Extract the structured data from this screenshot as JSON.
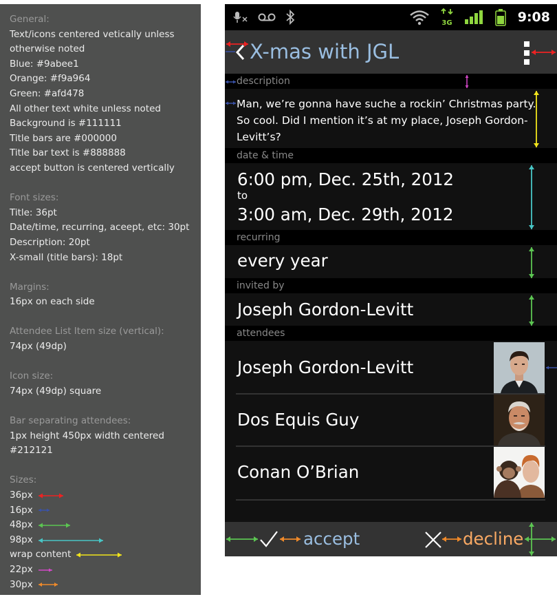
{
  "spec": {
    "general_header": "General:",
    "general_lines": [
      "Text/icons centered vetically unless",
      "otherwise noted",
      "Blue: #9abee1",
      "Orange: #f9a964",
      "Green: #afd478",
      "All other text white unless noted",
      "Background is #111111",
      "Title bars are #000000",
      "Title bar text is #888888",
      "accept button is centered vertically"
    ],
    "fonts_header": "Font sizes:",
    "fonts_lines": [
      "Title: 36pt",
      "Date/time, recurring, aceept, etc: 30pt",
      "Description: 20pt",
      "X-small (title bars): 18pt"
    ],
    "margins_header": "Margins:",
    "margins_lines": [
      "16px on each side"
    ],
    "attendee_header": "Attendee List Item size (vertical):",
    "attendee_lines": [
      "74px (49dp)"
    ],
    "icon_header": "Icon size:",
    "icon_lines": [
      "74px (49dp) square"
    ],
    "bar_header": "Bar separating attendees:",
    "bar_lines": [
      "1px height 450px width centered",
      "#212121"
    ],
    "sizes_header": "Sizes:",
    "sizes": [
      {
        "label": "36px",
        "color": "#ee2222"
      },
      {
        "label": "16px",
        "color": "#3a52a8"
      },
      {
        "label": "48px",
        "color": "#5cc552"
      },
      {
        "label": "98px",
        "color": "#48c6c6"
      },
      {
        "label": "wrap content",
        "color": "#f2e51c"
      },
      {
        "label": "22px",
        "color": "#d348c8"
      },
      {
        "label": "30px",
        "color": "#f08a2a"
      }
    ]
  },
  "status": {
    "time": "9:08",
    "icons": [
      "mic-muted-icon",
      "voicemail-icon",
      "bluetooth-icon",
      "wifi-icon",
      "3g-data-icon",
      "signal-icon",
      "battery-icon"
    ],
    "network": "3G"
  },
  "event": {
    "title": "X-mas with JGL",
    "description_label": "description",
    "description": "Man, we’re gonna have suche a rockin’ Christmas party. So cool. Did I mention it’s at my place, Joseph Gordon-Levitt’s?",
    "datetime_label": "date & time",
    "start": "6:00 pm, Dec. 25th, 2012",
    "to": "to",
    "end": "3:00 am, Dec. 29th, 2012",
    "recurring_label": "recurring",
    "recurring": "every year",
    "invited_label": "invited by",
    "invited_by": "Joseph Gordon-Levitt",
    "attendees_label": "attendees",
    "attendees": [
      {
        "name": "Joseph Gordon-Levitt"
      },
      {
        "name": "Dos Equis Guy"
      },
      {
        "name": "Conan O’Brian"
      }
    ]
  },
  "actions": {
    "accept": "accept",
    "decline": "decline"
  },
  "colors": {
    "blue": "#9abee1",
    "orange": "#f9a964",
    "green": "#afd478",
    "background": "#111111"
  }
}
